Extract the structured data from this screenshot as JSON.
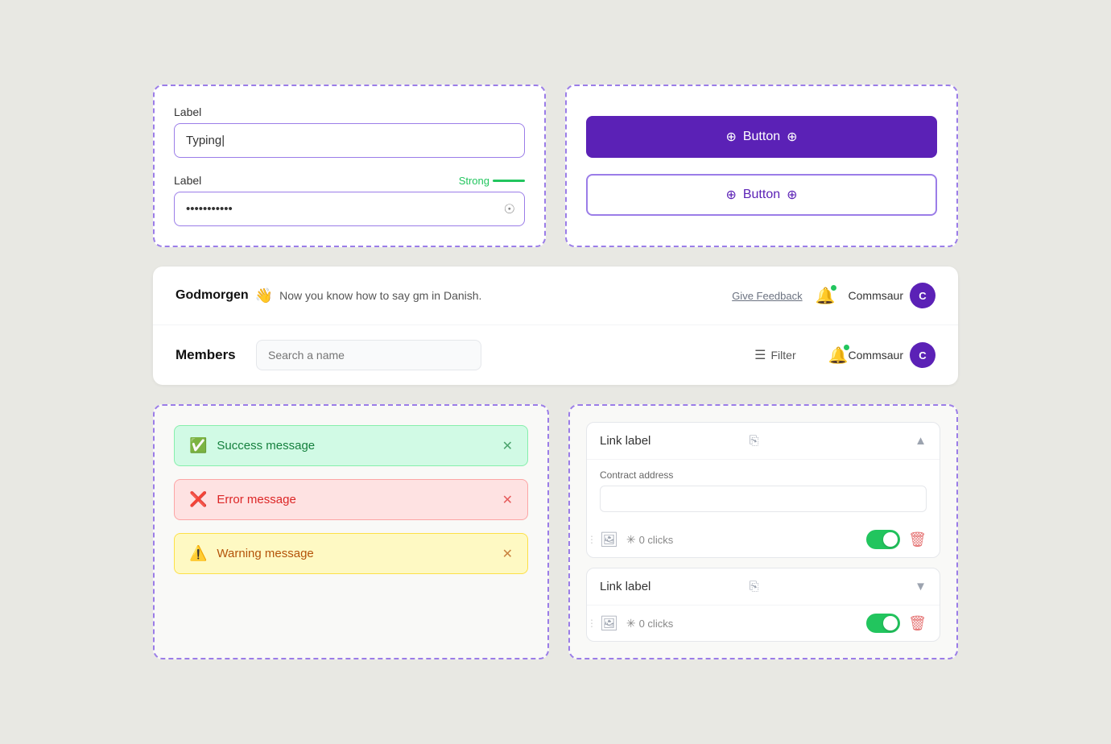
{
  "top_left": {
    "label1": "Label",
    "placeholder1": "Typing|",
    "label2": "Label",
    "strength_text": "Strong",
    "password_value": "••••••••••••"
  },
  "top_right": {
    "button_primary": "Button",
    "button_secondary": "Button"
  },
  "middle": {
    "greeting_bold": "Godmorgen",
    "greeting_emoji": "👋",
    "greeting_text": "Now you know how to say gm in Danish.",
    "feedback_link": "Give Feedback",
    "user_name": "Commsaur",
    "avatar_letter": "C",
    "members_title": "Members",
    "search_placeholder": "Search a name",
    "filter_label": "Filter",
    "user_name2": "Commsaur",
    "avatar_letter2": "C"
  },
  "bottom_left": {
    "success_text": "Success message",
    "error_text": "Error message",
    "warning_text": "Warning message"
  },
  "bottom_right": {
    "link1": {
      "label": "Link label",
      "contract_label": "Contract address",
      "contract_placeholder": "",
      "clicks": "0 clicks",
      "chevron": "▲"
    },
    "link2": {
      "label": "Link label",
      "clicks": "0 clicks",
      "chevron": "▼"
    }
  }
}
